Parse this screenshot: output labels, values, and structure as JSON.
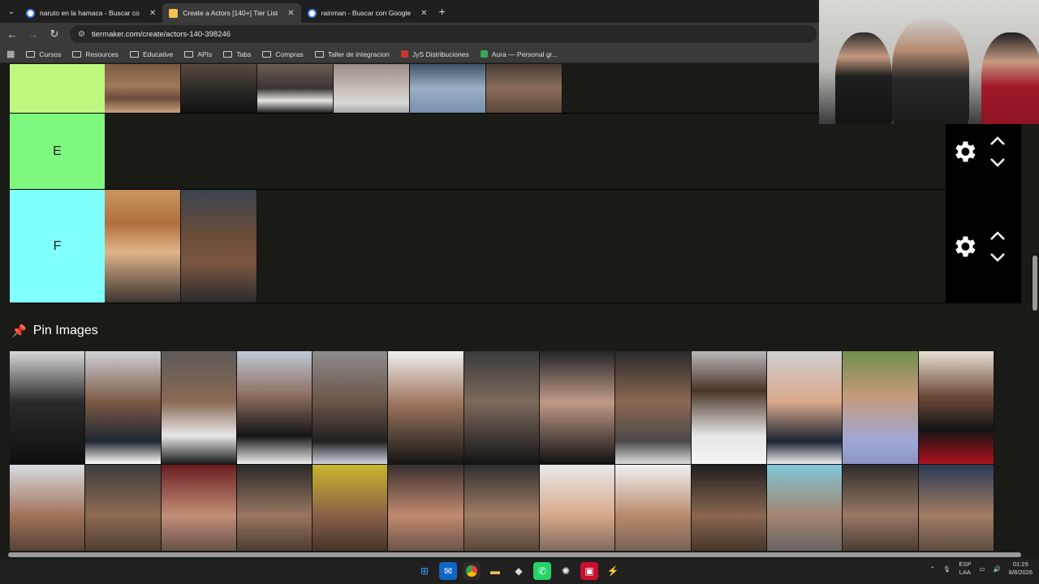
{
  "browser": {
    "tabs": [
      {
        "title": "naruto en la hamaca - Buscar co",
        "active": false,
        "icon": "google-icon"
      },
      {
        "title": "Create a Actors [140+] Tier List",
        "active": true,
        "icon": "tiermaker-icon"
      },
      {
        "title": "rainman - Buscar con Google",
        "active": false,
        "icon": "google-icon"
      }
    ],
    "url": "tiermaker.com/create/actors-140-398246",
    "bookmarks": [
      {
        "label": "Cursos",
        "icon": "folder-icon"
      },
      {
        "label": "Resources",
        "icon": "folder-icon"
      },
      {
        "label": "Educative",
        "icon": "folder-icon"
      },
      {
        "label": "APIs",
        "icon": "folder-icon"
      },
      {
        "label": "Tabs",
        "icon": "folder-icon"
      },
      {
        "label": "Compras",
        "icon": "folder-icon"
      },
      {
        "label": "Taller de integracion",
        "icon": "folder-icon"
      },
      {
        "label": "JyS Distribuciones",
        "icon": "site-icon"
      },
      {
        "label": "Aura — Personal gr...",
        "icon": "site-icon"
      }
    ]
  },
  "tiers": [
    {
      "label": "",
      "color": "#bff87f",
      "items": 6
    },
    {
      "label": "E",
      "color": "#7ff87f",
      "items": 0
    },
    {
      "label": "F",
      "color": "#7ffffe",
      "items": 2
    }
  ],
  "pin_section": {
    "title": "Pin Images"
  },
  "colors": {
    "background": "#1a1a17",
    "controls": "#000000",
    "tier_d": "#bff87f",
    "tier_e": "#7ff87f",
    "tier_f": "#7ffffe"
  },
  "taskbar": {
    "lang_top": "ESP",
    "lang_bottom": "LAA",
    "time": "01:29",
    "date": "8/8/2026"
  }
}
